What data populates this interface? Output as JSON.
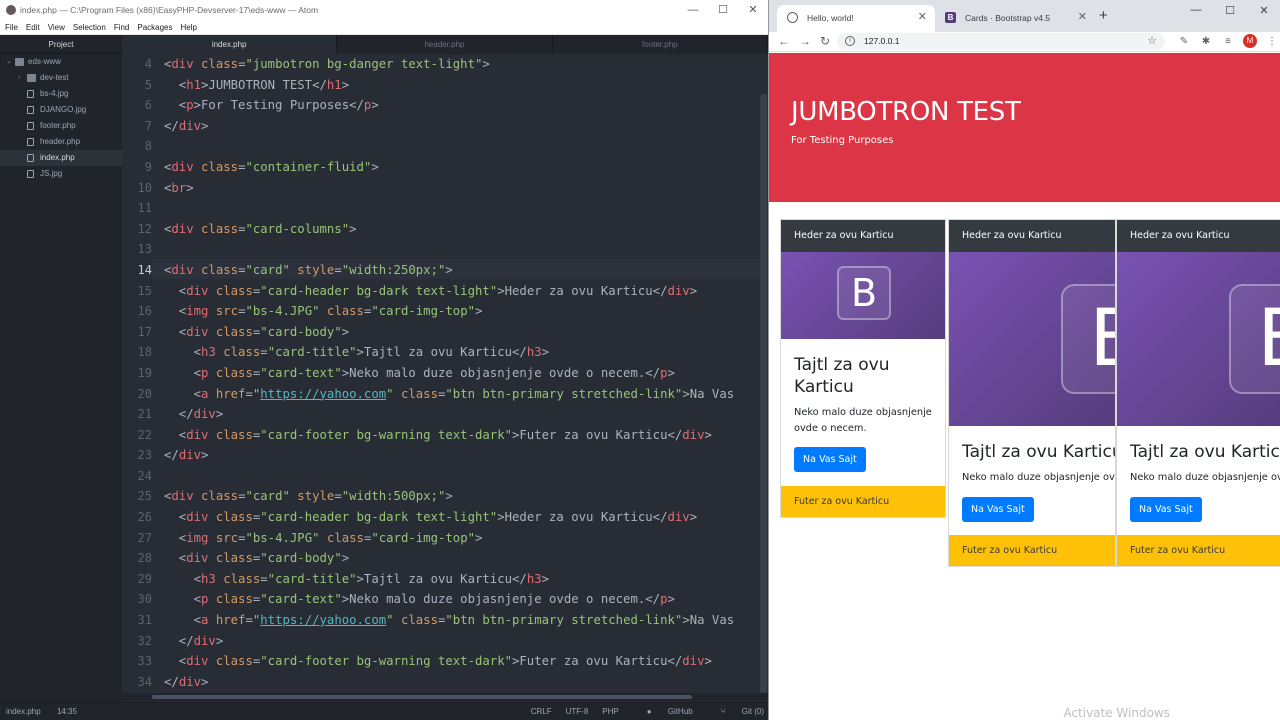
{
  "atom": {
    "title": "index.php — C:\\Program Files (x86)\\EasyPHP-Devserver-17\\eds-www — Atom",
    "window_controls": {
      "minimize": "—",
      "maximize": "☐",
      "close": "✕"
    },
    "menu": [
      "File",
      "Edit",
      "View",
      "Selection",
      "Find",
      "Packages",
      "Help"
    ],
    "tree": {
      "header": "Project",
      "items": [
        {
          "label": "eds-www",
          "type": "folder",
          "depth": 0,
          "chevron": "⌄"
        },
        {
          "label": "dev-test",
          "type": "folder",
          "depth": 1,
          "chevron": "›"
        },
        {
          "label": "bs-4.jpg",
          "type": "file",
          "depth": 1
        },
        {
          "label": "DJANGO.jpg",
          "type": "file",
          "depth": 1
        },
        {
          "label": "footer.php",
          "type": "file",
          "depth": 1
        },
        {
          "label": "header.php",
          "type": "file",
          "depth": 1
        },
        {
          "label": "index.php",
          "type": "file",
          "depth": 1,
          "selected": true
        },
        {
          "label": "JS.jpg",
          "type": "file",
          "depth": 1
        }
      ]
    },
    "tabs": [
      {
        "label": "index.php",
        "active": true
      },
      {
        "label": "header.php",
        "active": false
      },
      {
        "label": "footer.php",
        "active": false
      }
    ],
    "current_line": "14",
    "lines": [
      {
        "n": "4",
        "tokens": [
          [
            "pn",
            "<"
          ],
          [
            "tg",
            "div"
          ],
          [
            "pn",
            " "
          ],
          [
            "at",
            "class"
          ],
          [
            "pn",
            "="
          ],
          [
            "st",
            "\"jumbotron bg-danger text-light\""
          ],
          [
            "pn",
            ">"
          ]
        ]
      },
      {
        "n": "5",
        "tokens": [
          [
            "pn",
            "  <"
          ],
          [
            "tg",
            "h1"
          ],
          [
            "pn",
            ">JUMBOTRON TEST</"
          ],
          [
            "tg",
            "h1"
          ],
          [
            "pn",
            ">"
          ]
        ]
      },
      {
        "n": "6",
        "tokens": [
          [
            "pn",
            "  <"
          ],
          [
            "tg",
            "p"
          ],
          [
            "pn",
            ">For Testing Purposes</"
          ],
          [
            "tg",
            "p"
          ],
          [
            "pn",
            ">"
          ]
        ]
      },
      {
        "n": "7",
        "tokens": [
          [
            "pn",
            "</"
          ],
          [
            "tg",
            "div"
          ],
          [
            "pn",
            ">"
          ]
        ]
      },
      {
        "n": "8",
        "tokens": []
      },
      {
        "n": "9",
        "tokens": [
          [
            "pn",
            "<"
          ],
          [
            "tg",
            "div"
          ],
          [
            "pn",
            " "
          ],
          [
            "at",
            "class"
          ],
          [
            "pn",
            "="
          ],
          [
            "st",
            "\"container-fluid\""
          ],
          [
            "pn",
            ">"
          ]
        ]
      },
      {
        "n": "10",
        "tokens": [
          [
            "pn",
            "<"
          ],
          [
            "tg",
            "br"
          ],
          [
            "pn",
            ">"
          ]
        ]
      },
      {
        "n": "11",
        "tokens": []
      },
      {
        "n": "12",
        "tokens": [
          [
            "pn",
            "<"
          ],
          [
            "tg",
            "div"
          ],
          [
            "pn",
            " "
          ],
          [
            "at",
            "class"
          ],
          [
            "pn",
            "="
          ],
          [
            "st",
            "\"card-columns\""
          ],
          [
            "pn",
            ">"
          ]
        ]
      },
      {
        "n": "13",
        "tokens": []
      },
      {
        "n": "14",
        "tokens": [
          [
            "pn",
            "<"
          ],
          [
            "tg",
            "div"
          ],
          [
            "pn",
            " "
          ],
          [
            "at",
            "class"
          ],
          [
            "pn",
            "="
          ],
          [
            "st",
            "\"card\""
          ],
          [
            "pn",
            " "
          ],
          [
            "at",
            "style"
          ],
          [
            "pn",
            "="
          ],
          [
            "st",
            "\"width:250px;\""
          ],
          [
            "pn",
            ">"
          ]
        ]
      },
      {
        "n": "15",
        "tokens": [
          [
            "pn",
            "  <"
          ],
          [
            "tg",
            "div"
          ],
          [
            "pn",
            " "
          ],
          [
            "at",
            "class"
          ],
          [
            "pn",
            "="
          ],
          [
            "st",
            "\"card-header bg-dark text-light\""
          ],
          [
            "pn",
            ">Heder za ovu Karticu</"
          ],
          [
            "tg",
            "div"
          ],
          [
            "pn",
            ">"
          ]
        ]
      },
      {
        "n": "16",
        "tokens": [
          [
            "pn",
            "  <"
          ],
          [
            "tg",
            "img"
          ],
          [
            "pn",
            " "
          ],
          [
            "at",
            "src"
          ],
          [
            "pn",
            "="
          ],
          [
            "st",
            "\"bs-4.JPG\""
          ],
          [
            "pn",
            " "
          ],
          [
            "at",
            "class"
          ],
          [
            "pn",
            "="
          ],
          [
            "st",
            "\"card-img-top\""
          ],
          [
            "pn",
            ">"
          ]
        ]
      },
      {
        "n": "17",
        "tokens": [
          [
            "pn",
            "  <"
          ],
          [
            "tg",
            "div"
          ],
          [
            "pn",
            " "
          ],
          [
            "at",
            "class"
          ],
          [
            "pn",
            "="
          ],
          [
            "st",
            "\"card-body\""
          ],
          [
            "pn",
            ">"
          ]
        ]
      },
      {
        "n": "18",
        "tokens": [
          [
            "pn",
            "    <"
          ],
          [
            "tg",
            "h3"
          ],
          [
            "pn",
            " "
          ],
          [
            "at",
            "class"
          ],
          [
            "pn",
            "="
          ],
          [
            "st",
            "\"card-title\""
          ],
          [
            "pn",
            ">Tajtl za ovu Karticu</"
          ],
          [
            "tg",
            "h3"
          ],
          [
            "pn",
            ">"
          ]
        ]
      },
      {
        "n": "19",
        "tokens": [
          [
            "pn",
            "    <"
          ],
          [
            "tg",
            "p"
          ],
          [
            "pn",
            " "
          ],
          [
            "at",
            "class"
          ],
          [
            "pn",
            "="
          ],
          [
            "st",
            "\"card-text\""
          ],
          [
            "pn",
            ">Neko malo duze objasnjenje ovde o necem.</"
          ],
          [
            "tg",
            "p"
          ],
          [
            "pn",
            ">"
          ]
        ]
      },
      {
        "n": "20",
        "tokens": [
          [
            "pn",
            "    <"
          ],
          [
            "tg",
            "a"
          ],
          [
            "pn",
            " "
          ],
          [
            "at",
            "href"
          ],
          [
            "pn",
            "="
          ],
          [
            "st",
            "\""
          ],
          [
            "lk",
            "https://yahoo.com"
          ],
          [
            "st",
            "\""
          ],
          [
            "pn",
            " "
          ],
          [
            "at",
            "class"
          ],
          [
            "pn",
            "="
          ],
          [
            "st",
            "\"btn btn-primary stretched-link\""
          ],
          [
            "pn",
            ">Na Vas"
          ]
        ]
      },
      {
        "n": "21",
        "tokens": [
          [
            "pn",
            "  </"
          ],
          [
            "tg",
            "div"
          ],
          [
            "pn",
            ">"
          ]
        ]
      },
      {
        "n": "22",
        "tokens": [
          [
            "pn",
            "  <"
          ],
          [
            "tg",
            "div"
          ],
          [
            "pn",
            " "
          ],
          [
            "at",
            "class"
          ],
          [
            "pn",
            "="
          ],
          [
            "st",
            "\"card-footer bg-warning text-dark\""
          ],
          [
            "pn",
            ">Futer za ovu Karticu</"
          ],
          [
            "tg",
            "div"
          ],
          [
            "pn",
            ">"
          ]
        ]
      },
      {
        "n": "23",
        "tokens": [
          [
            "pn",
            "</"
          ],
          [
            "tg",
            "div"
          ],
          [
            "pn",
            ">"
          ]
        ]
      },
      {
        "n": "24",
        "tokens": []
      },
      {
        "n": "25",
        "tokens": [
          [
            "pn",
            "<"
          ],
          [
            "tg",
            "div"
          ],
          [
            "pn",
            " "
          ],
          [
            "at",
            "class"
          ],
          [
            "pn",
            "="
          ],
          [
            "st",
            "\"card\""
          ],
          [
            "pn",
            " "
          ],
          [
            "at",
            "style"
          ],
          [
            "pn",
            "="
          ],
          [
            "st",
            "\"width:500px;\""
          ],
          [
            "pn",
            ">"
          ]
        ]
      },
      {
        "n": "26",
        "tokens": [
          [
            "pn",
            "  <"
          ],
          [
            "tg",
            "div"
          ],
          [
            "pn",
            " "
          ],
          [
            "at",
            "class"
          ],
          [
            "pn",
            "="
          ],
          [
            "st",
            "\"card-header bg-dark text-light\""
          ],
          [
            "pn",
            ">Heder za ovu Karticu</"
          ],
          [
            "tg",
            "div"
          ],
          [
            "pn",
            ">"
          ]
        ]
      },
      {
        "n": "27",
        "tokens": [
          [
            "pn",
            "  <"
          ],
          [
            "tg",
            "img"
          ],
          [
            "pn",
            " "
          ],
          [
            "at",
            "src"
          ],
          [
            "pn",
            "="
          ],
          [
            "st",
            "\"bs-4.JPG\""
          ],
          [
            "pn",
            " "
          ],
          [
            "at",
            "class"
          ],
          [
            "pn",
            "="
          ],
          [
            "st",
            "\"card-img-top\""
          ],
          [
            "pn",
            ">"
          ]
        ]
      },
      {
        "n": "28",
        "tokens": [
          [
            "pn",
            "  <"
          ],
          [
            "tg",
            "div"
          ],
          [
            "pn",
            " "
          ],
          [
            "at",
            "class"
          ],
          [
            "pn",
            "="
          ],
          [
            "st",
            "\"card-body\""
          ],
          [
            "pn",
            ">"
          ]
        ]
      },
      {
        "n": "29",
        "tokens": [
          [
            "pn",
            "    <"
          ],
          [
            "tg",
            "h3"
          ],
          [
            "pn",
            " "
          ],
          [
            "at",
            "class"
          ],
          [
            "pn",
            "="
          ],
          [
            "st",
            "\"card-title\""
          ],
          [
            "pn",
            ">Tajtl za ovu Karticu</"
          ],
          [
            "tg",
            "h3"
          ],
          [
            "pn",
            ">"
          ]
        ]
      },
      {
        "n": "30",
        "tokens": [
          [
            "pn",
            "    <"
          ],
          [
            "tg",
            "p"
          ],
          [
            "pn",
            " "
          ],
          [
            "at",
            "class"
          ],
          [
            "pn",
            "="
          ],
          [
            "st",
            "\"card-text\""
          ],
          [
            "pn",
            ">Neko malo duze objasnjenje ovde o necem.</"
          ],
          [
            "tg",
            "p"
          ],
          [
            "pn",
            ">"
          ]
        ]
      },
      {
        "n": "31",
        "tokens": [
          [
            "pn",
            "    <"
          ],
          [
            "tg",
            "a"
          ],
          [
            "pn",
            " "
          ],
          [
            "at",
            "href"
          ],
          [
            "pn",
            "="
          ],
          [
            "st",
            "\""
          ],
          [
            "lk",
            "https://yahoo.com"
          ],
          [
            "st",
            "\""
          ],
          [
            "pn",
            " "
          ],
          [
            "at",
            "class"
          ],
          [
            "pn",
            "="
          ],
          [
            "st",
            "\"btn btn-primary stretched-link\""
          ],
          [
            "pn",
            ">Na Vas"
          ]
        ]
      },
      {
        "n": "32",
        "tokens": [
          [
            "pn",
            "  </"
          ],
          [
            "tg",
            "div"
          ],
          [
            "pn",
            ">"
          ]
        ]
      },
      {
        "n": "33",
        "tokens": [
          [
            "pn",
            "  <"
          ],
          [
            "tg",
            "div"
          ],
          [
            "pn",
            " "
          ],
          [
            "at",
            "class"
          ],
          [
            "pn",
            "="
          ],
          [
            "st",
            "\"card-footer bg-warning text-dark\""
          ],
          [
            "pn",
            ">Futer za ovu Karticu</"
          ],
          [
            "tg",
            "div"
          ],
          [
            "pn",
            ">"
          ]
        ]
      },
      {
        "n": "34",
        "tokens": [
          [
            "pn",
            "</"
          ],
          [
            "tg",
            "div"
          ],
          [
            "pn",
            ">"
          ]
        ]
      }
    ],
    "status": {
      "file": "index.php",
      "cursor": "14:35",
      "line_ending": "CRLF",
      "encoding": "UTF-8",
      "grammar": "PHP",
      "github": "GitHub",
      "git": "Git (0)"
    }
  },
  "chrome": {
    "tabs": [
      {
        "title": "Hello, world!",
        "active": true,
        "icon": "globe-icon"
      },
      {
        "title": "Cards · Bootstrap v4.5",
        "active": false,
        "icon": "bootstrap-icon"
      }
    ],
    "new_tab": "+",
    "window_controls": {
      "minimize": "—",
      "maximize": "☐",
      "close": "✕"
    },
    "nav": {
      "back": "←",
      "forward": "→",
      "reload": "↻"
    },
    "url": "127.0.0.1",
    "profile_initial": "M"
  },
  "page": {
    "jumbotron": {
      "title": "JUMBOTRON TEST",
      "subtitle": "For Testing Purposes",
      "color": "#dc3545"
    },
    "card": {
      "header": "Heder za ovu Karticu",
      "image_letter": "B",
      "title": "Tajtl za ovu Karticu",
      "title_wrapped": [
        "Tajtl za ovu",
        "Karticu"
      ],
      "text": "Neko malo duze objasnjenje ovde o necem.",
      "text_wrapped": [
        "Neko malo duze objasnjenje",
        "ovde o necem."
      ],
      "text_truncated": "Neko malo duze objasnjenje ovd",
      "button": "Na Vas Sajt",
      "footer": "Futer za ovu Karticu"
    }
  },
  "os": {
    "watermark": "Activate Windows"
  },
  "colors": {
    "editor_bg": "#282c34",
    "tag": "#e06c75",
    "attr": "#d19a66",
    "string": "#98c379",
    "primary": "#007bff",
    "warning": "#ffc107",
    "dark": "#343a40"
  }
}
